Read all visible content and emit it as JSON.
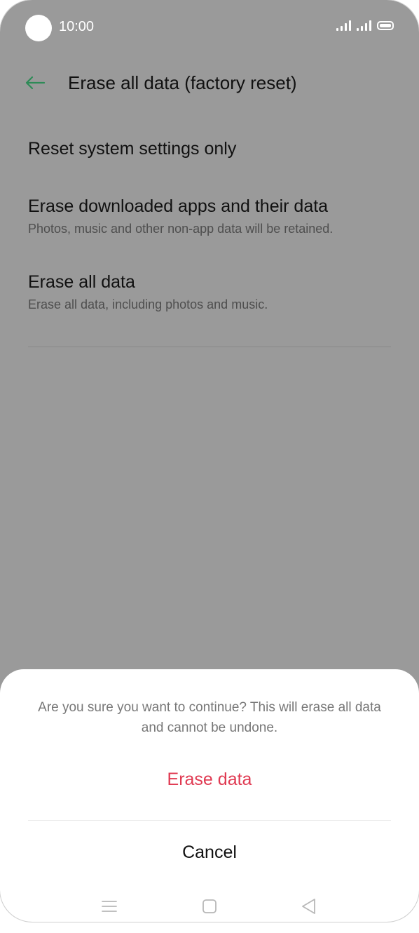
{
  "status_bar": {
    "time": "10:00",
    "icons": [
      "signal-icon",
      "signal-icon",
      "battery-icon"
    ]
  },
  "app_bar": {
    "back_icon": "arrow-left-icon",
    "title": "Erase all data (factory reset)",
    "accent_color": "#2e8b57"
  },
  "options": [
    {
      "title": "Reset system settings only",
      "subtitle": ""
    },
    {
      "title": "Erase downloaded apps and their data",
      "subtitle": "Photos, music and other non-app data will be retained."
    },
    {
      "title": "Erase all data",
      "subtitle": "Erase all data, including photos and music."
    }
  ],
  "dialog": {
    "message": "Are you sure you want to continue? This will erase all data and cannot be undone.",
    "erase_label": "Erase data",
    "cancel_label": "Cancel",
    "erase_color": "#e03a52"
  },
  "nav_bar": {
    "icons": [
      "menu-icon",
      "home-icon",
      "back-triangle-icon"
    ]
  }
}
